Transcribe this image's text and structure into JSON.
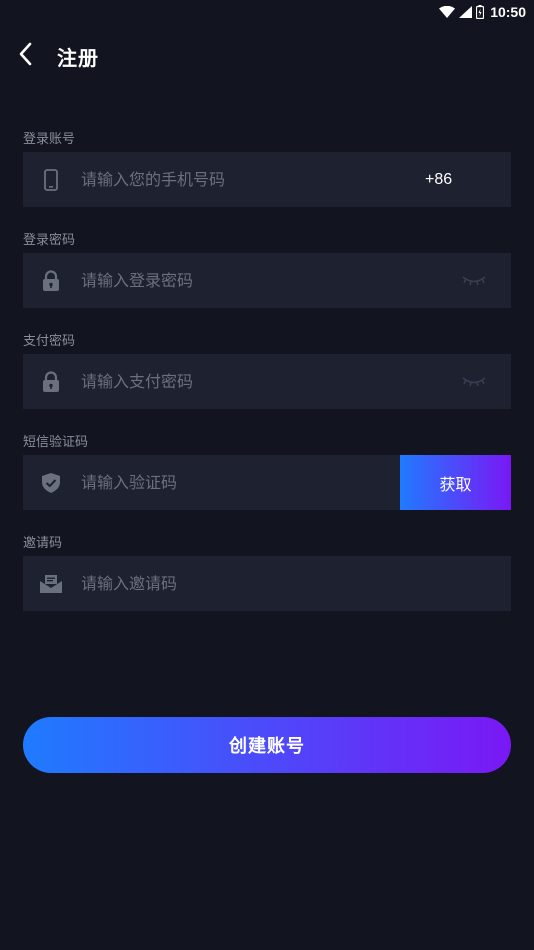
{
  "status_bar": {
    "time": "10:50",
    "icons": [
      "wifi-icon",
      "signal-icon",
      "battery-icon"
    ]
  },
  "header": {
    "back_icon": "chevron-left-icon",
    "title": "注册"
  },
  "form": {
    "account": {
      "label": "登录账号",
      "placeholder": "请输入您的手机号码",
      "value": "",
      "icon": "phone-icon",
      "country_code": "+86"
    },
    "password": {
      "label": "登录密码",
      "placeholder": "请输入登录密码",
      "value": "",
      "icon": "lock-icon",
      "toggle_icon": "eye-closed-icon"
    },
    "pay_password": {
      "label": "支付密码",
      "placeholder": "请输入支付密码",
      "value": "",
      "icon": "lock-icon",
      "toggle_icon": "eye-closed-icon"
    },
    "sms_code": {
      "label": "短信验证码",
      "placeholder": "请输入验证码",
      "value": "",
      "icon": "shield-check-icon",
      "button_label": "获取"
    },
    "invite_code": {
      "label": "邀请码",
      "placeholder": "请输入邀请码",
      "value": "",
      "icon": "mail-icon"
    }
  },
  "submit": {
    "label": "创建账号"
  },
  "colors": {
    "background": "#12151f",
    "field_background": "#1d2130",
    "label": "#8a8e9c",
    "placeholder": "#6b7080",
    "gradient_start": "#1f7bff",
    "gradient_end": "#7a18f5"
  }
}
